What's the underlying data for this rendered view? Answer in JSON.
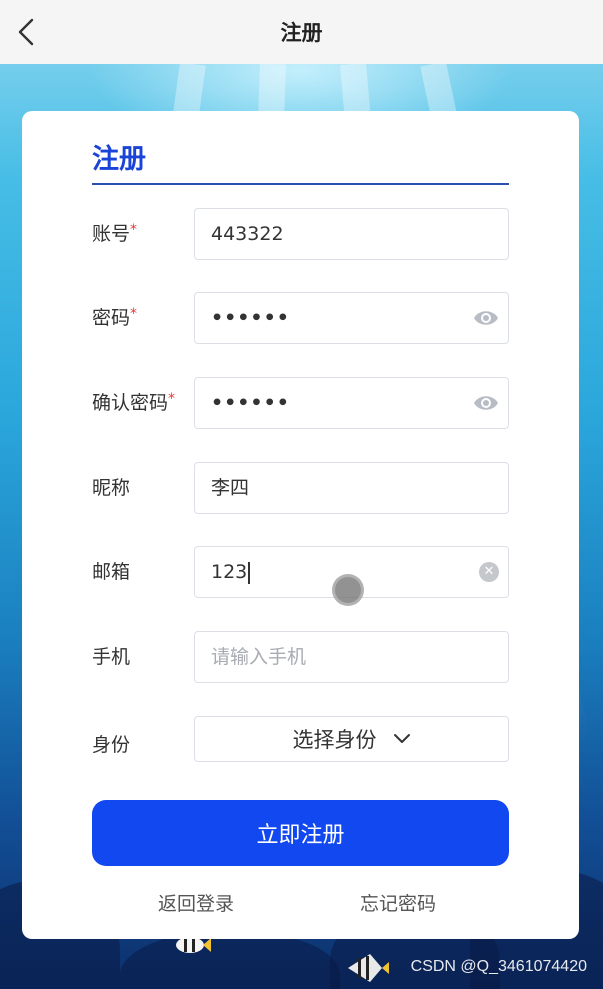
{
  "header": {
    "title": "注册"
  },
  "card": {
    "title": "注册"
  },
  "fields": [
    {
      "label": "账号",
      "required": true,
      "value": "443322",
      "type": "text"
    },
    {
      "label": "密码",
      "required": true,
      "value": "••••••",
      "type": "password"
    },
    {
      "label": "确认密码",
      "required": true,
      "value": "••••••",
      "type": "password"
    },
    {
      "label": "昵称",
      "required": false,
      "value": "李四",
      "type": "text"
    },
    {
      "label": "邮箱",
      "required": false,
      "value": "123",
      "type": "text"
    },
    {
      "label": "手机",
      "required": false,
      "value": "",
      "placeholder": "请输入手机",
      "type": "text"
    },
    {
      "label": "身份",
      "required": false,
      "value": "选择身份",
      "type": "select"
    }
  ],
  "required_mark": "*",
  "submit_label": "立即注册",
  "links": {
    "back_to_login": "返回登录",
    "forgot_password": "忘记密码"
  },
  "watermark": "CSDN @Q_3461074420",
  "colors": {
    "primary": "#1248f0",
    "title": "#1a44d8",
    "required": "#e53935",
    "header_bg": "#f5f5f5"
  },
  "icons": {
    "back": "chevron-left-icon",
    "password_toggle": "eye-icon",
    "clear": "clear-icon",
    "dropdown": "chevron-down-icon"
  }
}
